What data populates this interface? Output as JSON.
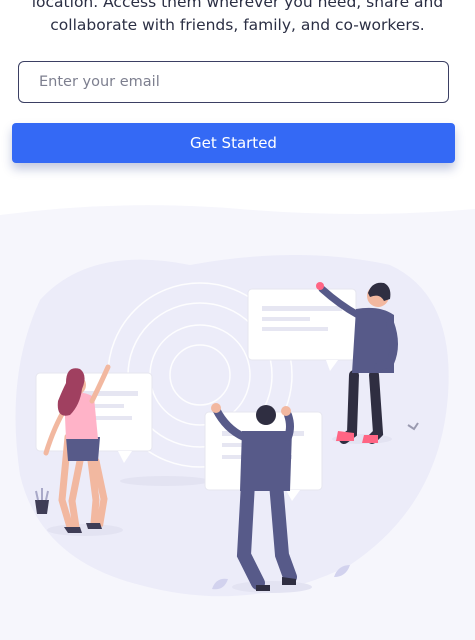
{
  "hero": {
    "line1": "location. Access them wherever you need, share and",
    "line2": "collaborate with friends, family, and co-workers."
  },
  "signup": {
    "email_placeholder": "Enter your email",
    "button_label": "Get Started"
  },
  "colors": {
    "primary": "#3469f5",
    "text": "#2b2f44",
    "section_bg": "#f6f6fc",
    "blob": "#ececf9",
    "suit": "#575a89",
    "pink": "#ff6584"
  }
}
